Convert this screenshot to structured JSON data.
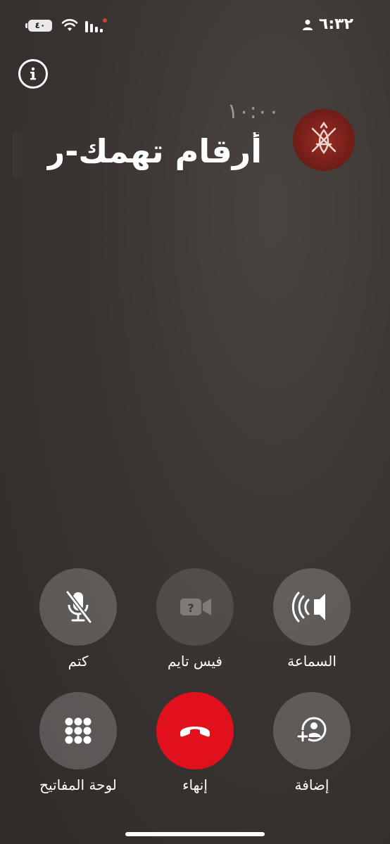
{
  "status_bar": {
    "battery": "٤٠",
    "time": "٦:٣٢"
  },
  "call": {
    "duration": "١٠:٠٠",
    "caller_name": "أرقام تهمك-ر"
  },
  "controls": {
    "speaker": "السماعة",
    "facetime": "فيس تايم",
    "mute": "كتم",
    "add": "إضافة",
    "end": "إنهاء",
    "keypad": "لوحة المفاتيح"
  },
  "colors": {
    "end_call": "#e0101d",
    "button_bg": "rgba(255,255,255,0.2)"
  },
  "icons": [
    "info-icon",
    "speaker-icon",
    "facetime-icon",
    "mute-icon",
    "add-call-icon",
    "end-call-icon",
    "keypad-icon"
  ]
}
